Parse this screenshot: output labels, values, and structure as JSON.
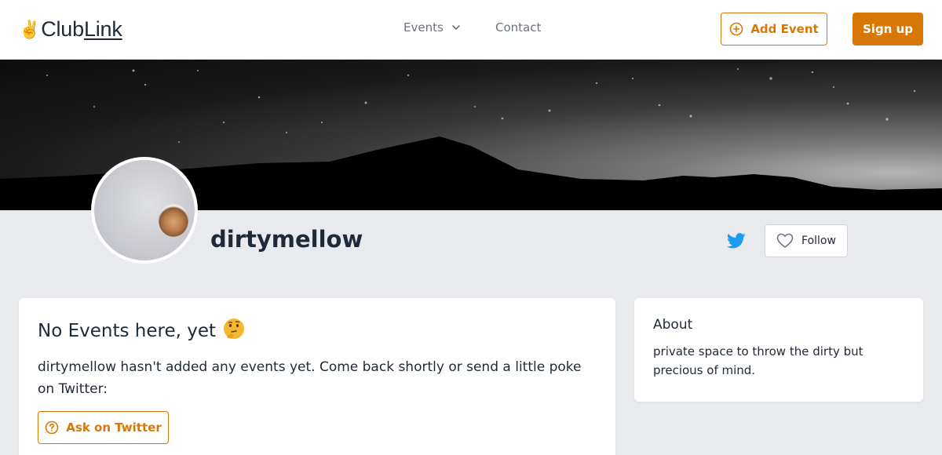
{
  "brand": {
    "name_club": "Club",
    "name_link": "Link",
    "emoji": "✌"
  },
  "nav": {
    "events_label": "Events",
    "contact_label": "Contact",
    "add_event_label": "Add Event",
    "signup_label": "Sign up"
  },
  "profile": {
    "username": "dirtymellow",
    "follow_label": "Follow"
  },
  "events_card": {
    "title": "No Events here, yet",
    "emoji": "🤔",
    "message": "dirtymellow hasn't added any events yet. Come back shortly or send a little poke on Twitter:",
    "ask_button_label": "Ask on Twitter"
  },
  "about_card": {
    "title": "About",
    "text": "private space to throw the dirty but precious of mind."
  },
  "colors": {
    "accent": "#d97706",
    "twitter": "#1d9bf0",
    "page_bg": "#e8eaee"
  }
}
